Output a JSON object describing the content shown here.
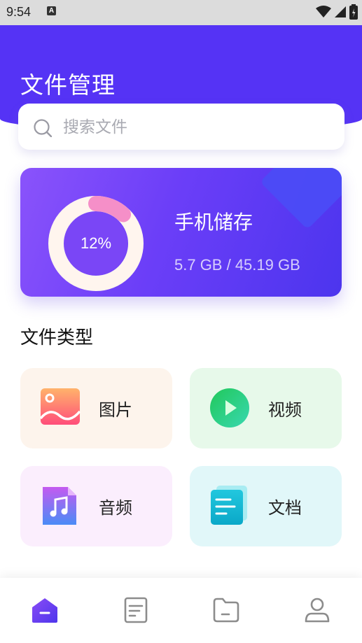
{
  "status_bar": {
    "time": "9:54",
    "notification_badge": "A",
    "icons": [
      "wifi-icon",
      "signal-icon",
      "battery-icon"
    ]
  },
  "header": {
    "title": "文件管理"
  },
  "search": {
    "placeholder": "搜索文件",
    "icon": "search-icon"
  },
  "storage_card": {
    "title": "手机储存",
    "used_percent_label": "12%",
    "used_fraction": 0.12,
    "size_text": "5.7 GB / 45.19 GB"
  },
  "file_types": {
    "section_title": "文件类型",
    "items": [
      {
        "label": "图片",
        "icon": "image-icon",
        "bg": "#fdf4ec"
      },
      {
        "label": "视频",
        "icon": "video-play-icon",
        "bg": "#e7f9ea"
      },
      {
        "label": "音频",
        "icon": "music-icon",
        "bg": "#fbeefd"
      },
      {
        "label": "文档",
        "icon": "document-icon",
        "bg": "#e1f7f9"
      }
    ]
  },
  "bottom_nav": {
    "items": [
      {
        "name": "home",
        "icon": "home-icon",
        "active": true
      },
      {
        "name": "documents",
        "icon": "document-icon",
        "active": false
      },
      {
        "name": "folders",
        "icon": "folder-icon",
        "active": false
      },
      {
        "name": "profile",
        "icon": "user-icon",
        "active": false
      }
    ]
  },
  "colors": {
    "primary": "#5533f5",
    "accent_pink": "#f58fc8",
    "nav_inactive": "#8c8c8c"
  }
}
